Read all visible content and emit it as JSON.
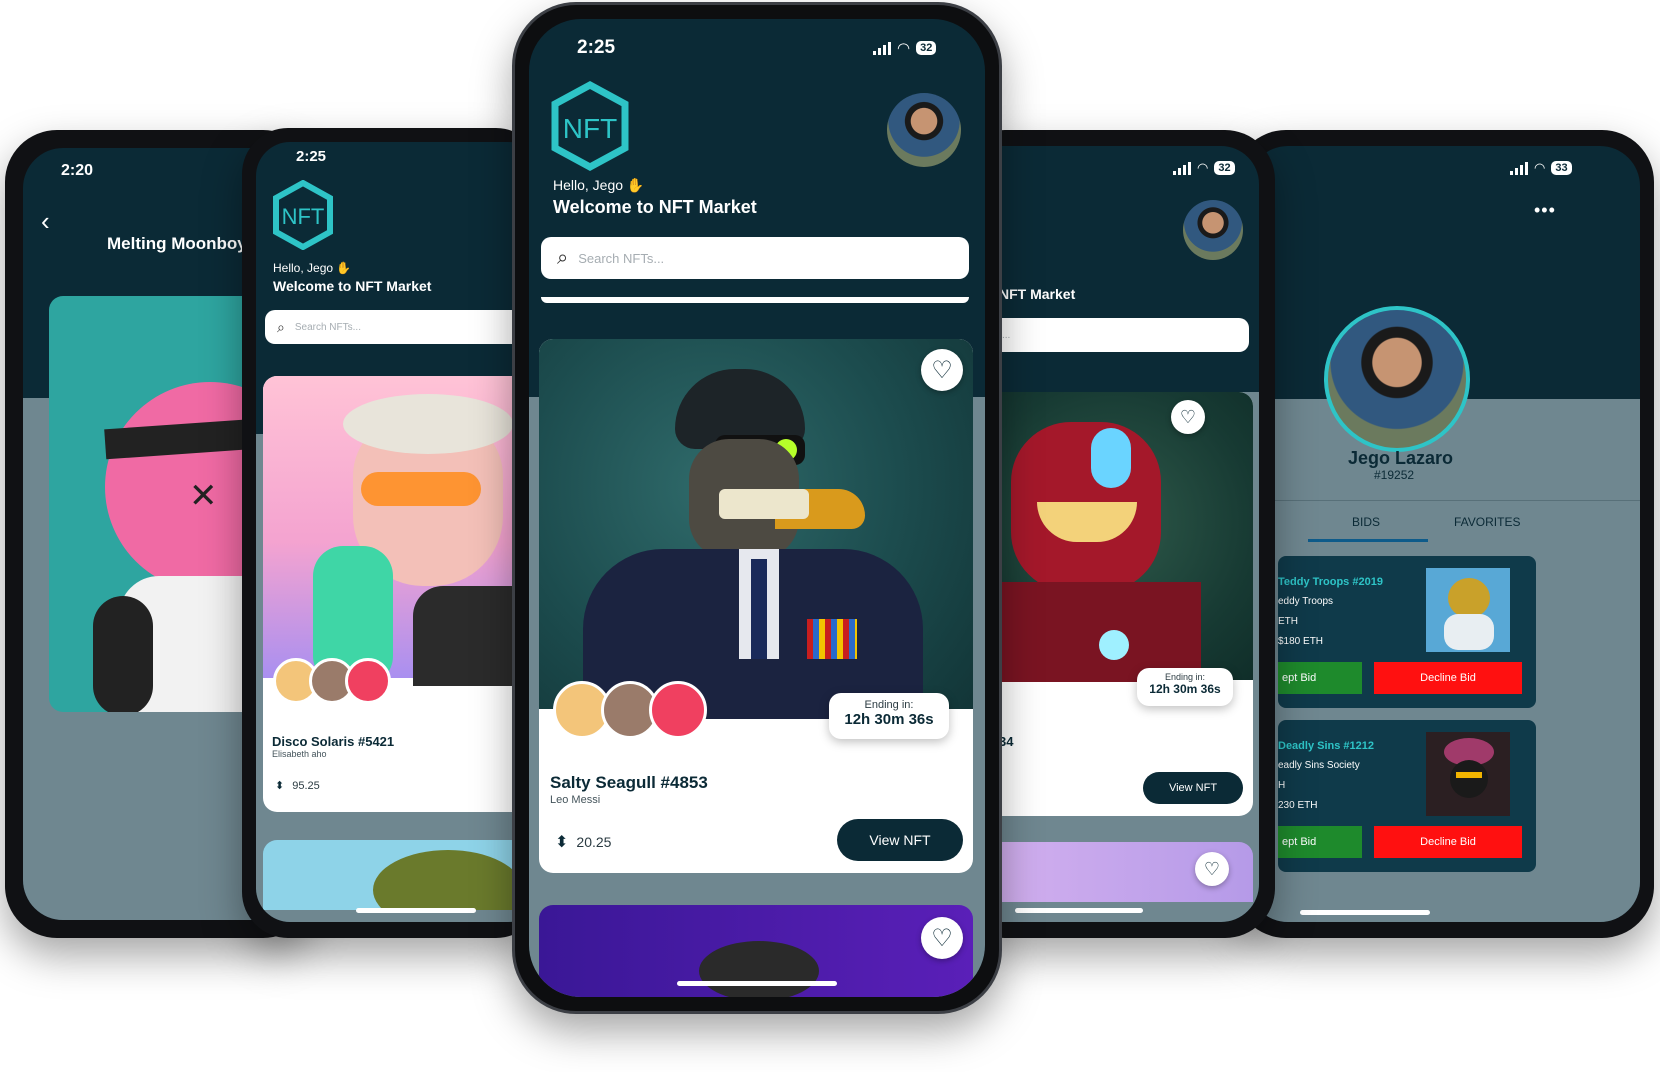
{
  "phone1": {
    "time": "2:20",
    "title": "Melting Moonboy"
  },
  "phone2": {
    "time": "2:25",
    "greeting": "Hello, Jego",
    "welcome": "Welcome to NFT Market",
    "search_placeholder": "Search NFTs...",
    "card": {
      "title": "Disco Solaris #5421",
      "author": "Elisabeth aho",
      "price": "95.25"
    }
  },
  "phone3": {
    "time": "2:25",
    "battery": "32",
    "logo_text": "NFT",
    "greeting": "Hello, Jego",
    "welcome": "Welcome to NFT Market",
    "search_placeholder": "Search NFTs...",
    "card": {
      "title": "Salty Seagull #4853",
      "author": "Leo Messi",
      "price": "20.25",
      "ending_label": "Ending in:",
      "ending_value": "12h 30m 36s",
      "button": "View NFT"
    }
  },
  "phone4": {
    "battery": "32",
    "welcome_partial": "NFT Market",
    "search_partial": "s...",
    "card": {
      "ending_label": "Ending in:",
      "ending_value": "12h 30m 36s",
      "title_partial": "34",
      "button": "View NFT"
    }
  },
  "phone5": {
    "battery": "33",
    "menu": "•••",
    "name": "Jego Lazaro",
    "id": "#19252",
    "tabs": [
      "BIDS",
      "FAVORITES"
    ],
    "bids": [
      {
        "title": "Teddy Troops #2019",
        "collection": "eddy Troops",
        "currency": "ETH",
        "amount": "$180 ETH",
        "accept": "ept Bid",
        "decline": "Decline Bid"
      },
      {
        "title": "Deadly Sins #1212",
        "collection": "eadly Sins Society",
        "currency": "H",
        "amount": "230 ETH",
        "accept": "ept Bid",
        "decline": "Decline Bid"
      }
    ]
  }
}
